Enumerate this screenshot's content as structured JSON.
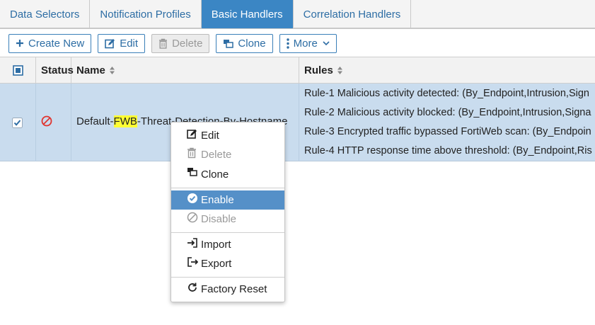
{
  "tabs": [
    {
      "label": "Data Selectors"
    },
    {
      "label": "Notification Profiles"
    },
    {
      "label": "Basic Handlers"
    },
    {
      "label": "Correlation Handlers"
    }
  ],
  "active_tab": "Basic Handlers",
  "toolbar": {
    "create_new": "Create New",
    "edit": "Edit",
    "delete": "Delete",
    "clone": "Clone",
    "more": "More"
  },
  "table": {
    "columns": {
      "status": "Status",
      "name": "Name",
      "rules": "Rules"
    },
    "row": {
      "name_prefix": "Default-",
      "name_highlight": "FWB",
      "name_suffix": "-Threat-Detection-By-Hostname",
      "rules": [
        "Rule-1 Malicious activity detected: (By_Endpoint,Intrusion,Sign",
        "Rule-2 Malicious activity blocked: (By_Endpoint,Intrusion,Signa",
        "Rule-3 Encrypted traffic bypassed FortiWeb scan: (By_Endpoin",
        "Rule-4 HTTP response time above threshold: (By_Endpoint,Ris"
      ]
    }
  },
  "context_menu": {
    "edit": "Edit",
    "delete": "Delete",
    "clone": "Clone",
    "enable": "Enable",
    "disable": "Disable",
    "import": "Import",
    "export": "Export",
    "factory_reset": "Factory Reset"
  },
  "colors": {
    "accent": "#3b86c4",
    "link": "#2d6da4",
    "row_selected": "#c9dcee",
    "highlight": "#ffff33",
    "menu_selected": "#5590c8",
    "status_disabled": "#e0342e"
  }
}
